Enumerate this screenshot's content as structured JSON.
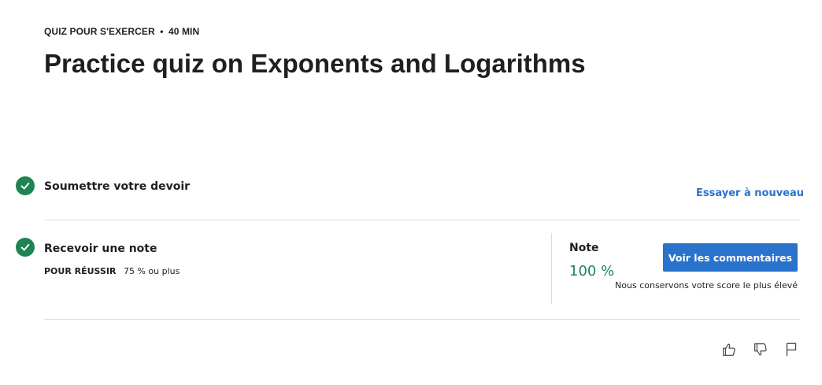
{
  "header": {
    "type_label": "QUIZ POUR S'EXERCER",
    "separator": "•",
    "duration": "40  MIN",
    "title": "Practice quiz on Exponents and Logarithms"
  },
  "submit_step": {
    "label": "Soumettre votre devoir",
    "retry_link": "Essayer à nouveau"
  },
  "grade_step": {
    "label": "Recevoir une note",
    "pass_label": "POUR RÉUSSIR",
    "pass_value": "75 % ou plus",
    "grade_label": "Note",
    "grade_value": "100 %",
    "feedback_button": "Voir les commentaires",
    "score_note": "Nous conservons votre score le plus élevé"
  },
  "colors": {
    "success": "#1f8354",
    "primary": "#2a73cc",
    "divider": "#dcdcdc"
  },
  "footer_icons": [
    "thumbs-up-icon",
    "thumbs-down-icon",
    "flag-icon"
  ]
}
